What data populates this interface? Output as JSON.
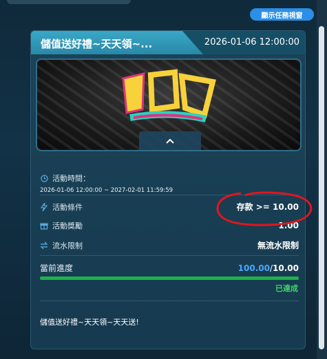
{
  "top_button": {
    "label": "顯示任務視窗"
  },
  "card": {
    "title": "儲值送好禮~天天領~...",
    "date": "2026-01-06 12:00:00",
    "collapse_icon": "chevron-up-icon",
    "activity_time": {
      "label": "活動時間：",
      "range": "2026-01-06 12:00:00 ~ 2027-02-01 11:59:59"
    },
    "condition": {
      "label": "活動條件",
      "value": "存款 >= 10.00"
    },
    "reward": {
      "label": "活動獎勵",
      "value": "1.00"
    },
    "turnover": {
      "label": "流水限制",
      "value": "無流水限制"
    },
    "progress": {
      "label": "當前進度",
      "current": "100.00",
      "separator": "/",
      "target": "10.00",
      "fraction": 1.0,
      "status": "已達成"
    },
    "description": "儲值送好禮~天天領~天天送!"
  },
  "colors": {
    "accent_blue": "#2b8fe8",
    "progress_green": "#1fb04a",
    "achieved_green": "#3fd46a",
    "current_blue": "#4aa8ff",
    "annotation_red": "#e0161e"
  }
}
